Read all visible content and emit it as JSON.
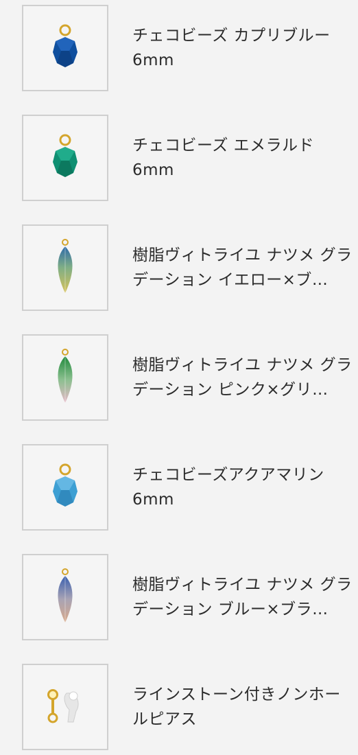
{
  "products": [
    {
      "name": "チェコビーズ カプリブルー\n6mm",
      "image": "bead-icon",
      "color": "#0f4f9e"
    },
    {
      "name": "チェコビーズ エメラルド\n6mm",
      "image": "bead-icon",
      "color": "#0f8f72"
    },
    {
      "name": "樹脂ヴィトライユ ナツメ グラデーション イエロー×ブ…",
      "image": "drop-icon",
      "colors": [
        "#2e6aa8",
        "#d6c25a"
      ]
    },
    {
      "name": "樹脂ヴィトライユ ナツメ グラデーション ピンク×グリ…",
      "image": "drop-icon",
      "colors": [
        "#1f8a3c",
        "#e6b9c7"
      ]
    },
    {
      "name": "チェコビーズアクアマリン\n6mm",
      "image": "bead-icon",
      "color": "#3d9fd3"
    },
    {
      "name": "樹脂ヴィトライユ ナツメ グラデーション ブルー×ブラ…",
      "image": "drop-icon",
      "colors": [
        "#3a5fae",
        "#d8a98a"
      ]
    },
    {
      "name": "ラインストーン付きノンホールピアス",
      "image": "earring-icon",
      "color": "#e5e5e5"
    }
  ]
}
